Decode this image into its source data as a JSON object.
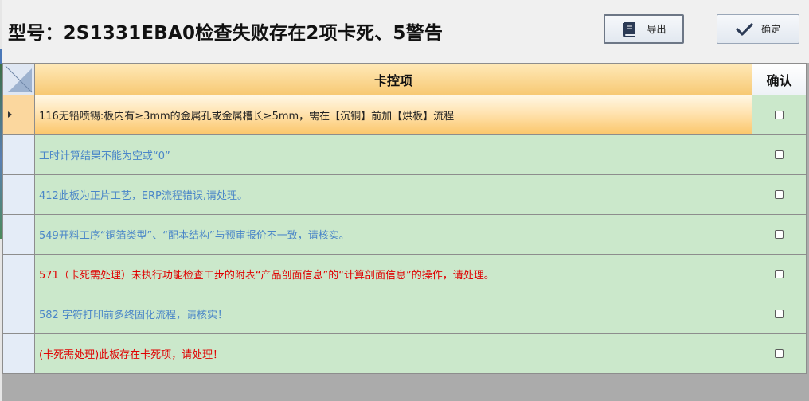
{
  "title": "型号：2S1331EBA0检查失败存在2项卡死、5警告",
  "toolbar": {
    "export_label": "导出",
    "confirm_label": "确定"
  },
  "grid": {
    "columns": [
      "卡控项",
      "确认"
    ],
    "rows": [
      {
        "text": "116无铅喷锡:板内有≥3mm的金属孔或金属槽长≥5mm，需在【沉铜】前加【烘板】流程",
        "color": "#222222",
        "checked": false,
        "current": true
      },
      {
        "text": "工时计算结果不能为空或“0”",
        "color": "#4a86c8",
        "checked": false,
        "current": false
      },
      {
        "text": "412此板为正片工艺，ERP流程错误,请处理。",
        "color": "#4a86c8",
        "checked": false,
        "current": false
      },
      {
        "text": "549开料工序“铜箔类型”、“配本结构”与预审报价不一致，请核实。",
        "color": "#4a86c8",
        "checked": false,
        "current": false
      },
      {
        "text": "571（卡死需处理）未执行功能检查工步的附表“产品剖面信息”的“计算剖面信息”的操作，请处理。",
        "color": "#e00000",
        "checked": false,
        "current": false
      },
      {
        "text": "582 字符打印前多终固化流程，请核实！",
        "color": "#4a86c8",
        "checked": false,
        "current": false
      },
      {
        "text": "(卡死需处理)此板存在卡死项，请处理！",
        "color": "#e00000",
        "checked": false,
        "current": false
      }
    ]
  },
  "colors": {
    "warning_text": "#4a86c8",
    "fatal_text": "#e00000",
    "row_bg": "#cbe8cb",
    "header_bg": "#f7c974"
  }
}
